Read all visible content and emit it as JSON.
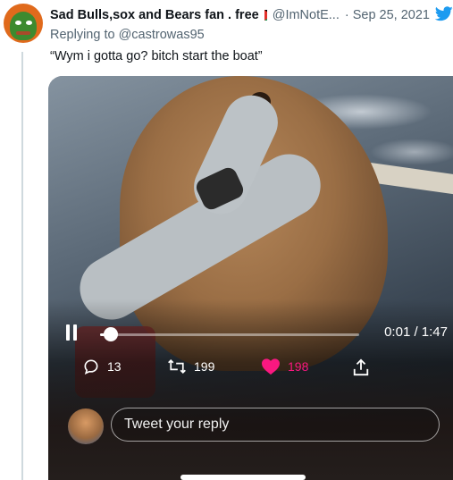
{
  "tweet": {
    "display_name": "Sad Bulls,sox and Bears fan . free",
    "handle": "@ImNotE...",
    "separator": "·",
    "date": "Sep 25, 2021",
    "replying_prefix": "Replying to",
    "replying_to": "@castrowas95",
    "text": "“Wym i gotta go? bitch start the boat”"
  },
  "video": {
    "time": "0:01 / 1:47",
    "progress": 0.02,
    "actions": {
      "reply_count": "13",
      "retweet_count": "199",
      "like_count": "198"
    },
    "reply_placeholder": "Tweet your reply",
    "colors": {
      "like": "#f91880",
      "twitter_blue": "#1d9bf0"
    }
  },
  "icons": {
    "verified_bird": "twitter-bird-icon",
    "pause": "pause-icon",
    "reply": "reply-icon",
    "retweet": "retweet-icon",
    "like": "heart-icon",
    "share": "share-icon"
  }
}
